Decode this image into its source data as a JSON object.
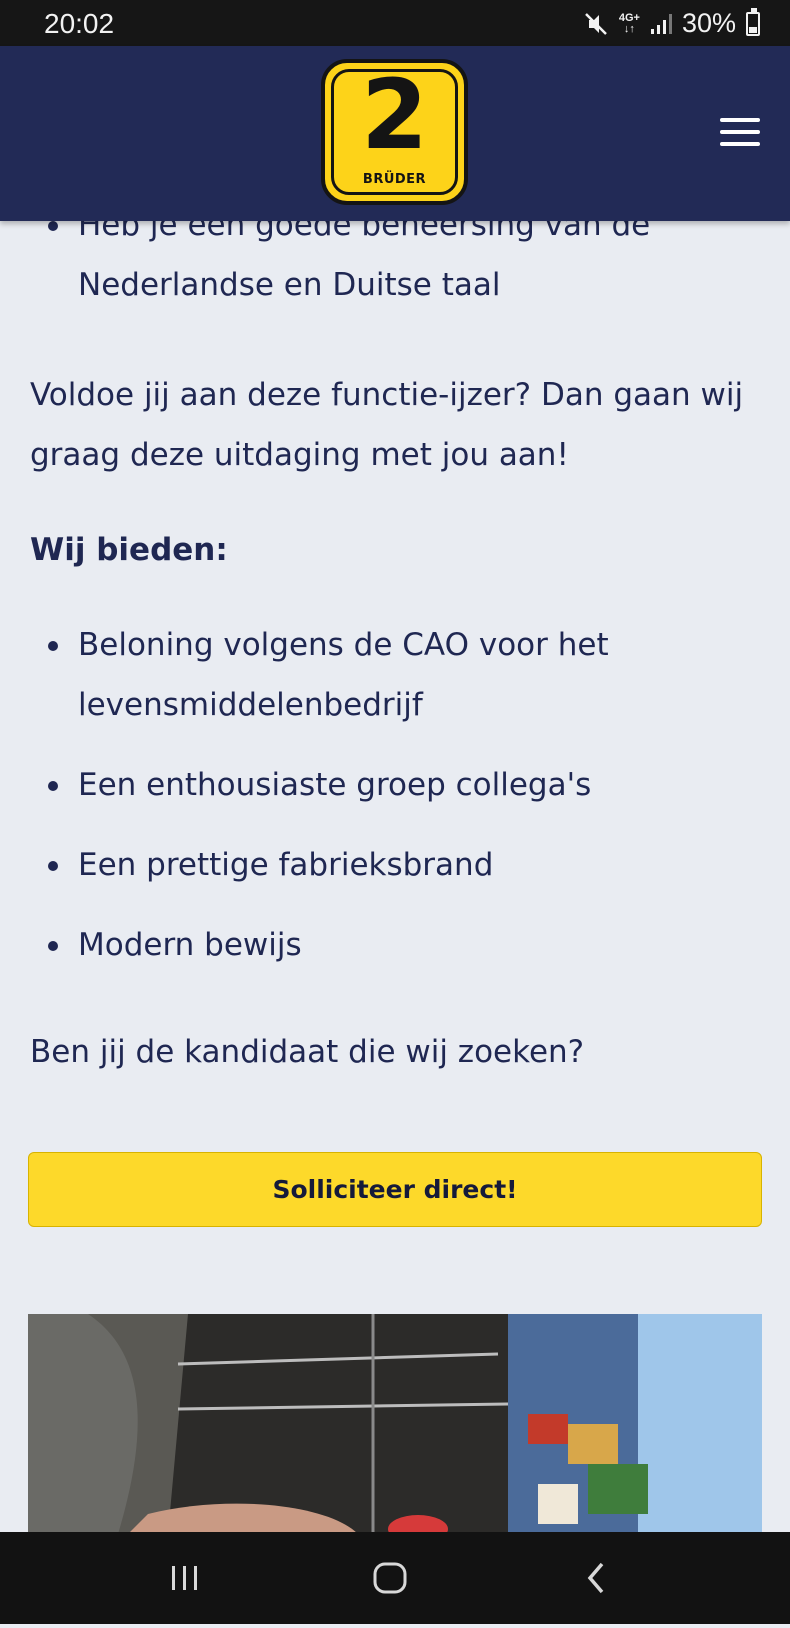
{
  "status_bar": {
    "time": "20:02",
    "network": "4G+",
    "battery": "30%",
    "icons": [
      "mute-icon",
      "network-4g-icon",
      "signal-icon",
      "battery-icon"
    ]
  },
  "header": {
    "logo": {
      "number": "2",
      "word": "BRÜDER"
    },
    "menu_icon": "hamburger-menu-icon",
    "brand_colors": {
      "navy": "#222a56",
      "yellow": "#fdd319"
    }
  },
  "content": {
    "requirements_tail": [
      "Heb je een goede beheersing van de Nederlandse en Duitse taal"
    ],
    "question": "Voldoe jij aan deze functie-ijzer? Dan gaan wij graag deze uitdaging met jou aan!",
    "offer_heading": "Wij bieden:",
    "offers": [
      "Beloning volgens de CAO voor het levensmiddelenbedrijf",
      "Een enthousiaste groep collega's",
      "Een prettige fabrieksbrand",
      "Modern bewijs"
    ],
    "closing": "Ben jij de kandidaat die wij zoeken?",
    "apply_label": "Solliciteer direct!"
  },
  "nav_bar": {
    "icons": [
      "recent-apps-icon",
      "home-icon",
      "back-icon"
    ]
  }
}
